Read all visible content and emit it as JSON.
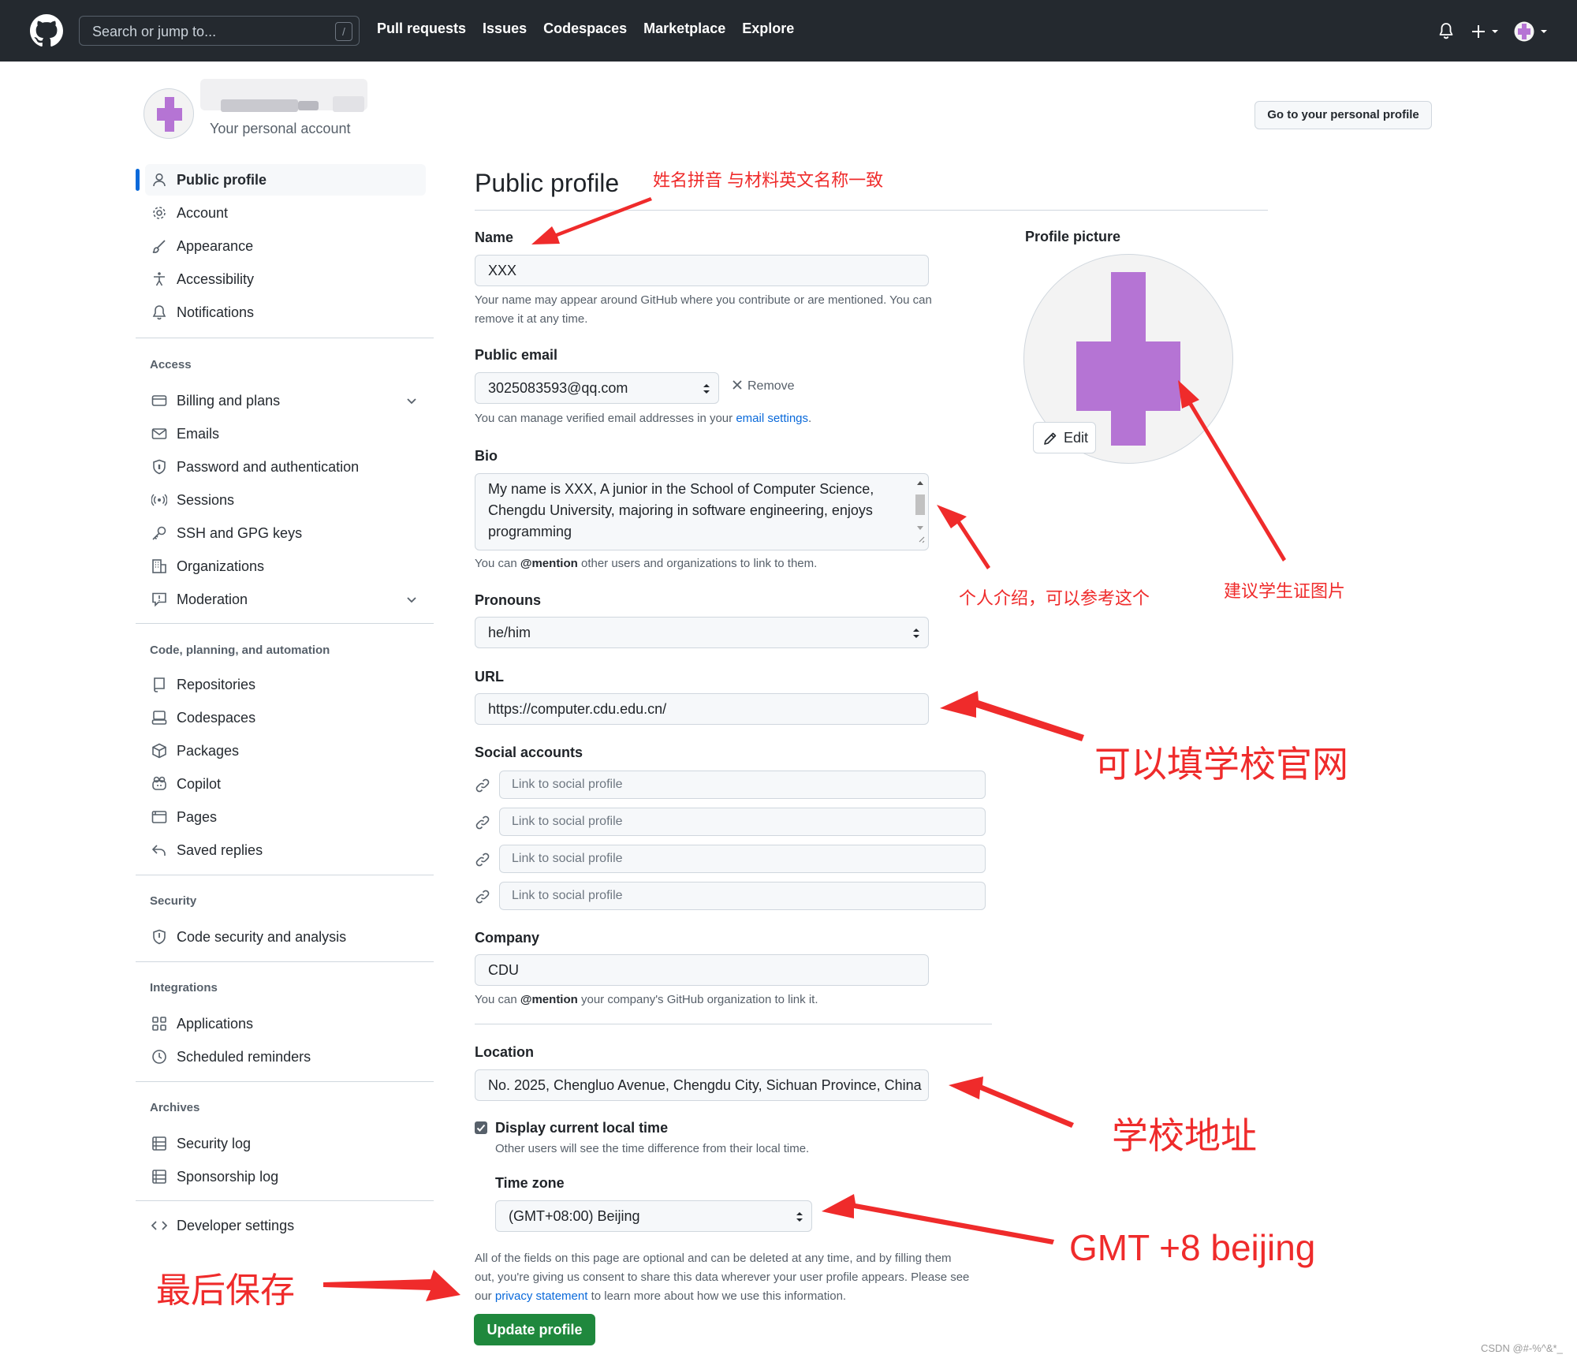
{
  "header": {
    "search_placeholder": "Search or jump to...",
    "search_shortcut": "/",
    "nav": [
      "Pull requests",
      "Issues",
      "Codespaces",
      "Marketplace",
      "Explore"
    ]
  },
  "account": {
    "subtitle": "Your personal account",
    "go_to_profile": "Go to your personal profile"
  },
  "sidebar": {
    "main": [
      "Public profile",
      "Account",
      "Appearance",
      "Accessibility",
      "Notifications"
    ],
    "access_heading": "Access",
    "access": [
      "Billing and plans",
      "Emails",
      "Password and authentication",
      "Sessions",
      "SSH and GPG keys",
      "Organizations",
      "Moderation"
    ],
    "code_heading": "Code, planning, and automation",
    "code": [
      "Repositories",
      "Codespaces",
      "Packages",
      "Copilot",
      "Pages",
      "Saved replies"
    ],
    "security_heading": "Security",
    "security": [
      "Code security and analysis"
    ],
    "integrations_heading": "Integrations",
    "integrations": [
      "Applications",
      "Scheduled reminders"
    ],
    "archives_heading": "Archives",
    "archives": [
      "Security log",
      "Sponsorship log"
    ],
    "developer": "Developer settings"
  },
  "form": {
    "title": "Public profile",
    "name_label": "Name",
    "name_value": "XXX",
    "name_note_1": "Your name may appear around GitHub where you contribute or are mentioned. You can",
    "name_note_2": "remove it at any time.",
    "email_label": "Public email",
    "email_value": "3025083593@qq.com",
    "email_remove": "Remove",
    "email_note_pre": "You can manage verified email addresses in your ",
    "email_note_link": "email settings",
    "email_note_post": ".",
    "bio_label": "Bio",
    "bio_value": "My name is XXX, A junior in the School of Computer Science, Chengdu University, majoring in software engineering, enjoys programming",
    "bio_note_pre": "You can ",
    "bio_note_mention": "@mention",
    "bio_note_post": " other users and organizations to link to them.",
    "pronouns_label": "Pronouns",
    "pronouns_value": "he/him",
    "url_label": "URL",
    "url_value": "https://computer.cdu.edu.cn/",
    "social_label": "Social accounts",
    "social_placeholder": "Link to social profile",
    "company_label": "Company",
    "company_value": "CDU",
    "company_note_pre": "You can ",
    "company_note_mention": "@mention",
    "company_note_post": " your company's GitHub organization to link it.",
    "location_label": "Location",
    "location_value": "No. 2025, Chengluo Avenue, Chengdu City, Sichuan Province, China",
    "localtime_label": "Display current local time",
    "localtime_note": "Other users will see the time difference from their local time.",
    "timezone_label": "Time zone",
    "timezone_value": "(GMT+08:00) Beijing",
    "footer_1": "All of the fields on this page are optional and can be deleted at any time, and by filling them",
    "footer_2": "out, you're giving us consent to share this data wherever your user profile appears. Please see",
    "footer_3_pre": "our ",
    "footer_3_link": "privacy statement",
    "footer_3_post": " to learn more about how we use this information.",
    "update_button": "Update profile"
  },
  "profile_picture": {
    "label": "Profile picture",
    "edit": "Edit"
  },
  "annotations": {
    "name_hint": "姓名拼音 与材料英文名称一致",
    "bio_hint": "个人介绍，可以参考这个",
    "picture_hint": "建议学生证图片",
    "url_hint": "可以填学校官网",
    "location_hint": "学校地址",
    "timezone_hint": "GMT +8 beijing",
    "save_hint": "最后保存"
  },
  "watermark": "CSDN @#-%^&*_",
  "colors": {
    "header_bg": "#24292f",
    "accent": "#0969da",
    "primary_button": "#1f883d",
    "avatar_purple": "#b574d4",
    "annotation_red": "#ef2b2b"
  }
}
